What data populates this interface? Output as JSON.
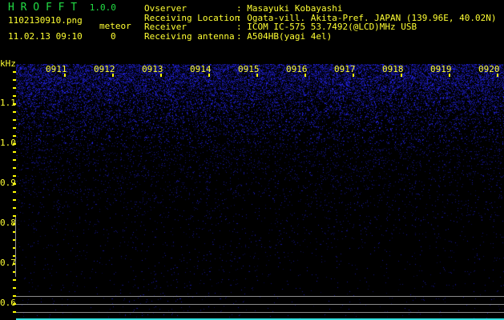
{
  "app": {
    "name": "H R O F F T",
    "version": "1.0.0"
  },
  "file": {
    "name": "1102130910.png",
    "datetime": "11.02.13 09:10"
  },
  "meteor": {
    "label": "meteor",
    "count": "0"
  },
  "info": [
    {
      "label": "Ovserver",
      "value": ": Masayuki Kobayashi"
    },
    {
      "label": "Receiving Location",
      "value": ": Ogata-vill. Akita-Pref. JAPAN (139.96E, 40.02N)"
    },
    {
      "label": "Receiver",
      "value": ": ICOM IC-575 53.7492(@LCD)MHz USB"
    },
    {
      "label": "Receiving antenna",
      "value": ": A504HB(yagi 4el)"
    }
  ],
  "axis": {
    "y_unit": "kHz",
    "y_labels": [
      "1.1",
      "1.0",
      "0.9",
      "0.8",
      "0.7",
      "0.6"
    ],
    "x_labels": [
      "0911",
      "0912",
      "0913",
      "0914",
      "0915",
      "0916",
      "0917",
      "0918",
      "0919",
      "0920"
    ]
  },
  "colors": {
    "text": "#ffff33",
    "logo": "#22dd44",
    "noise": "#2222ff",
    "baseline": "#33e0e0"
  }
}
